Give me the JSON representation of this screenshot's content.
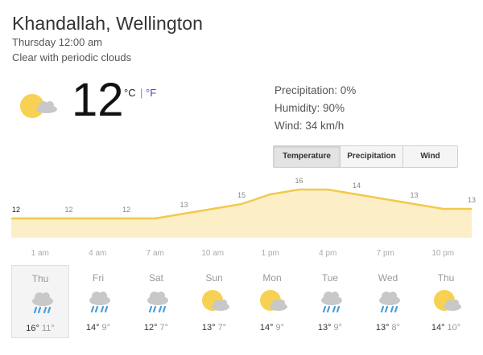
{
  "header": {
    "location": "Khandallah, Wellington",
    "time": "Thursday 12:00 am",
    "condition": "Clear with periodic clouds"
  },
  "current": {
    "icon": "partly-cloudy-icon",
    "temperature": "12",
    "unit_c": "°C",
    "unit_sep": "|",
    "unit_f": "°F"
  },
  "stats": {
    "precipitation": "Precipitation: 0%",
    "humidity": "Humidity: 90%",
    "wind": "Wind: 34 km/h"
  },
  "tabs": [
    {
      "label": "Temperature",
      "active": true
    },
    {
      "label": "Precipitation",
      "active": false
    },
    {
      "label": "Wind",
      "active": false
    }
  ],
  "colors": {
    "line": "#f2c94c",
    "fill": "#fcefc7",
    "sun": "#f7d154",
    "cloud": "#c8c8c8",
    "rain": "#4a9fd8",
    "link": "#5b3fd6"
  },
  "chart_data": {
    "type": "area",
    "x": [
      "",
      "1 am",
      "",
      "4 am",
      "",
      "7 am",
      "",
      "10 am",
      "",
      "1 pm",
      "",
      "4 pm",
      "",
      "7 pm",
      "",
      "10 pm",
      ""
    ],
    "series": [
      {
        "values": [
          12,
          12,
          12,
          12,
          12,
          12,
          12.5,
          13,
          13.5,
          14.5,
          15,
          15,
          14.5,
          14,
          13.5,
          13,
          13
        ]
      }
    ],
    "labels": [
      {
        "i": 0,
        "text": "12"
      },
      {
        "i": 2,
        "text": "12"
      },
      {
        "i": 4,
        "text": "12"
      },
      {
        "i": 6,
        "text": "13"
      },
      {
        "i": 8,
        "text": "15"
      },
      {
        "i": 10,
        "text": "16"
      },
      {
        "i": 12,
        "text": "14"
      },
      {
        "i": 14,
        "text": "13"
      },
      {
        "i": 16,
        "text": "13"
      }
    ],
    "ylim": [
      10,
      17
    ]
  },
  "forecast": [
    {
      "day": "Thu",
      "icon": "rain-icon",
      "high": "16°",
      "low": "11°",
      "selected": true
    },
    {
      "day": "Fri",
      "icon": "rain-icon",
      "high": "14°",
      "low": "9°",
      "selected": false
    },
    {
      "day": "Sat",
      "icon": "rain-icon",
      "high": "12°",
      "low": "7°",
      "selected": false
    },
    {
      "day": "Sun",
      "icon": "partly-sunny-icon",
      "high": "13°",
      "low": "7°",
      "selected": false
    },
    {
      "day": "Mon",
      "icon": "partly-sunny-icon",
      "high": "14°",
      "low": "9°",
      "selected": false
    },
    {
      "day": "Tue",
      "icon": "rain-icon",
      "high": "13°",
      "low": "9°",
      "selected": false
    },
    {
      "day": "Wed",
      "icon": "rain-icon",
      "high": "13°",
      "low": "8°",
      "selected": false
    },
    {
      "day": "Thu",
      "icon": "partly-sunny-icon",
      "high": "14°",
      "low": "10°",
      "selected": false
    }
  ]
}
